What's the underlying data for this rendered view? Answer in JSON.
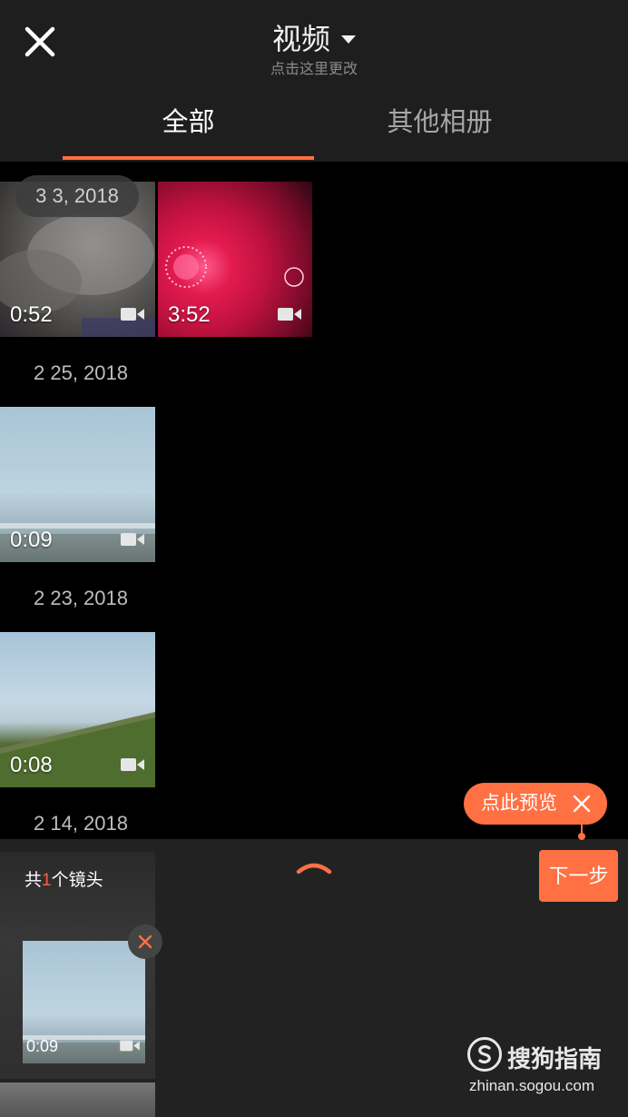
{
  "header": {
    "title": "视频",
    "subtitle": "点击这里更改"
  },
  "tabs": [
    {
      "label": "全部",
      "active": true
    },
    {
      "label": "其他相册",
      "active": false
    }
  ],
  "groups": [
    {
      "date": "3 3, 2018",
      "items": [
        {
          "duration": "0:52"
        },
        {
          "duration": "3:52"
        }
      ]
    },
    {
      "date": "2 25, 2018",
      "items": [
        {
          "duration": "0:09"
        }
      ]
    },
    {
      "date": "2 23, 2018",
      "items": [
        {
          "duration": "0:08"
        }
      ]
    },
    {
      "date": "2 14, 2018",
      "items": []
    }
  ],
  "preview_tip": {
    "label": "点此预览"
  },
  "bottom": {
    "count_prefix": "共",
    "count_value": "1",
    "count_suffix": "个镜头",
    "next_label": "下一步",
    "selected": [
      {
        "duration": "0:09"
      }
    ]
  },
  "watermark": {
    "brand": "搜狗指南",
    "url": "zhinan.sogou.com"
  },
  "colors": {
    "accent": "#ff7043",
    "header_bg": "#1e1e1e",
    "panel_bg": "#222222"
  },
  "icons": [
    "close-icon",
    "caret-down-icon",
    "video-camera-icon",
    "chevron-up-icon",
    "remove-icon",
    "sogou-logo-icon"
  ]
}
